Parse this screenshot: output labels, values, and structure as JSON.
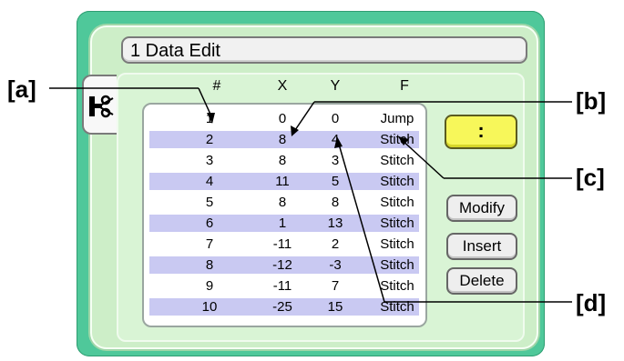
{
  "window": {
    "title": "1 Data Edit"
  },
  "table": {
    "headers": [
      "#",
      "X",
      "Y",
      "F"
    ],
    "rows": [
      {
        "n": "1",
        "x": "0",
        "y": "0",
        "f": "Jump"
      },
      {
        "n": "2",
        "x": "8",
        "y": "4",
        "f": "Stitch"
      },
      {
        "n": "3",
        "x": "8",
        "y": "3",
        "f": "Stitch"
      },
      {
        "n": "4",
        "x": "11",
        "y": "5",
        "f": "Stitch"
      },
      {
        "n": "5",
        "x": "8",
        "y": "8",
        "f": "Stitch"
      },
      {
        "n": "6",
        "x": "1",
        "y": "13",
        "f": "Stitch"
      },
      {
        "n": "7",
        "x": "-11",
        "y": "2",
        "f": "Stitch"
      },
      {
        "n": "8",
        "x": "-12",
        "y": "-3",
        "f": "Stitch"
      },
      {
        "n": "9",
        "x": "-11",
        "y": "7",
        "f": "Stitch"
      },
      {
        "n": "10",
        "x": "-25",
        "y": "15",
        "f": "Stitch"
      }
    ]
  },
  "buttons": {
    "colon": ":",
    "modify": "Modify",
    "insert": "Insert",
    "delete": "Delete"
  },
  "callouts": {
    "a": "[a]",
    "b": "[b]",
    "c": "[c]",
    "d": "[d]"
  },
  "icons": {
    "sidetab": "scissors-icon"
  },
  "colors": {
    "device": "#4fc89a",
    "screen": "#cdeec8",
    "row_alt": "#c9c9f2",
    "colon_button": "#f7f75a"
  }
}
